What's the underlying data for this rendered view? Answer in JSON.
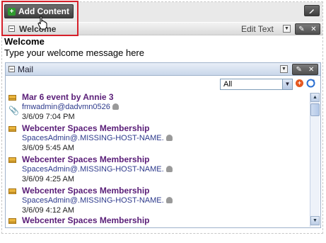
{
  "toolbar": {
    "add_content_label": "Add Content"
  },
  "welcome": {
    "title": "Welcome",
    "edit_label": "Edit Text",
    "heading": "Welcome",
    "message": "Type your welcome message here"
  },
  "mail": {
    "title": "Mail",
    "filter": {
      "selected": "All"
    },
    "messages": [
      {
        "subject": "Mar 6 event by Annie 3",
        "sender": "fmwadmin@dadvmn0526",
        "date": "3/6/09 7:04 PM",
        "has_attachment": true
      },
      {
        "subject": "Webcenter Spaces Membership",
        "sender": "SpacesAdmin@.MISSING-HOST-NAME.",
        "date": "3/6/09 5:45 AM",
        "has_attachment": false
      },
      {
        "subject": "Webcenter Spaces Membership",
        "sender": "SpacesAdmin@.MISSING-HOST-NAME.",
        "date": "3/6/09 4:25 AM",
        "has_attachment": false
      },
      {
        "subject": "Webcenter Spaces Membership",
        "sender": "SpacesAdmin@.MISSING-HOST-NAME.",
        "date": "3/6/09 4:12 AM",
        "has_attachment": false
      },
      {
        "subject": "Webcenter Spaces Membership",
        "sender": "",
        "date": "",
        "has_attachment": false
      }
    ]
  },
  "colors": {
    "highlight": "#d6202a",
    "subject": "#5a1e78",
    "sender": "#2d3a8c"
  }
}
